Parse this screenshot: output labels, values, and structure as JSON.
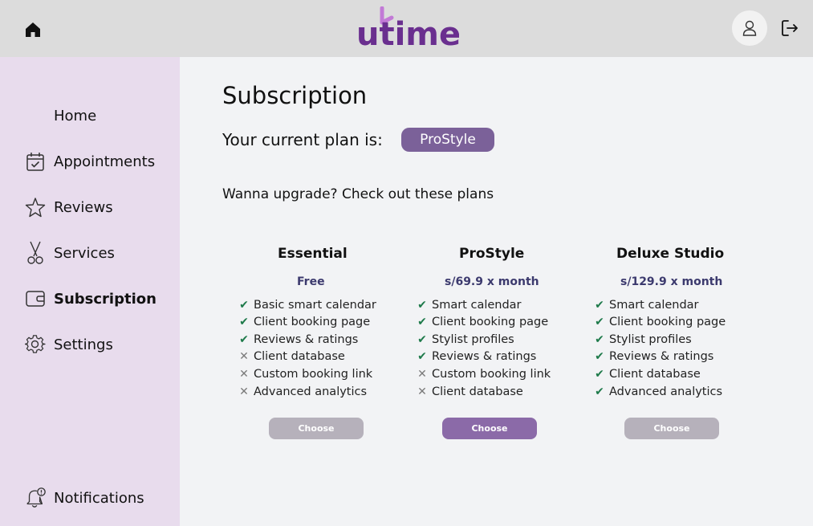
{
  "header": {
    "logo_text": "utime",
    "icons": [
      "home-icon",
      "user-icon",
      "logout-icon"
    ]
  },
  "sidebar": {
    "items": [
      {
        "label": "Home",
        "icon": "none"
      },
      {
        "label": "Appointments",
        "icon": "calendar-check-icon"
      },
      {
        "label": "Reviews",
        "icon": "star-icon"
      },
      {
        "label": "Services",
        "icon": "scissors-icon"
      },
      {
        "label": "Subscription",
        "icon": "wallet-icon",
        "active": true
      },
      {
        "label": "Settings",
        "icon": "gear-icon"
      },
      {
        "label": "Notifications",
        "icon": "bell-alert-icon"
      }
    ]
  },
  "main": {
    "title": "Subscription",
    "current_plan_label": "Your current plan is:",
    "current_plan": "ProStyle",
    "upgrade_text": "Wanna upgrade? Check out these plans"
  },
  "plans": [
    {
      "name": "Essential",
      "price": "Free",
      "features": [
        {
          "text": "Basic smart calendar",
          "included": true
        },
        {
          "text": "Client booking page",
          "included": true
        },
        {
          "text": "Reviews & ratings",
          "included": true
        },
        {
          "text": "Client database",
          "included": false
        },
        {
          "text": "Custom booking link",
          "included": false
        },
        {
          "text": "Advanced analytics",
          "included": false
        }
      ],
      "button": "Choose"
    },
    {
      "name": "ProStyle",
      "price": "s/69.9 x month",
      "features": [
        {
          "text": "Smart calendar",
          "included": true
        },
        {
          "text": "Client booking page",
          "included": true
        },
        {
          "text": "Stylist profiles",
          "included": true
        },
        {
          "text": "Reviews & ratings",
          "included": true
        },
        {
          "text": "Custom booking link",
          "included": false
        },
        {
          "text": "Client database",
          "included": false
        }
      ],
      "button": "Choose"
    },
    {
      "name": "Deluxe Studio",
      "price": "s/129.9 x month",
      "features": [
        {
          "text": "Smart calendar",
          "included": true
        },
        {
          "text": "Client booking page",
          "included": true
        },
        {
          "text": "Stylist profiles",
          "included": true
        },
        {
          "text": "Reviews & ratings",
          "included": true
        },
        {
          "text": "Client database",
          "included": true
        },
        {
          "text": "Advanced analytics",
          "included": true
        }
      ],
      "button": "Choose"
    }
  ],
  "marks": {
    "yes": "✔",
    "no": "✕"
  },
  "colors": {
    "topbar": "#dcdcdc",
    "sidebar": "#e8dced",
    "brand": "#6a2f8f",
    "badge": "#7b6199",
    "check": "#1e7a4a",
    "choose_primary": "#8b6aa8",
    "choose_muted": "#b6b1bb"
  }
}
